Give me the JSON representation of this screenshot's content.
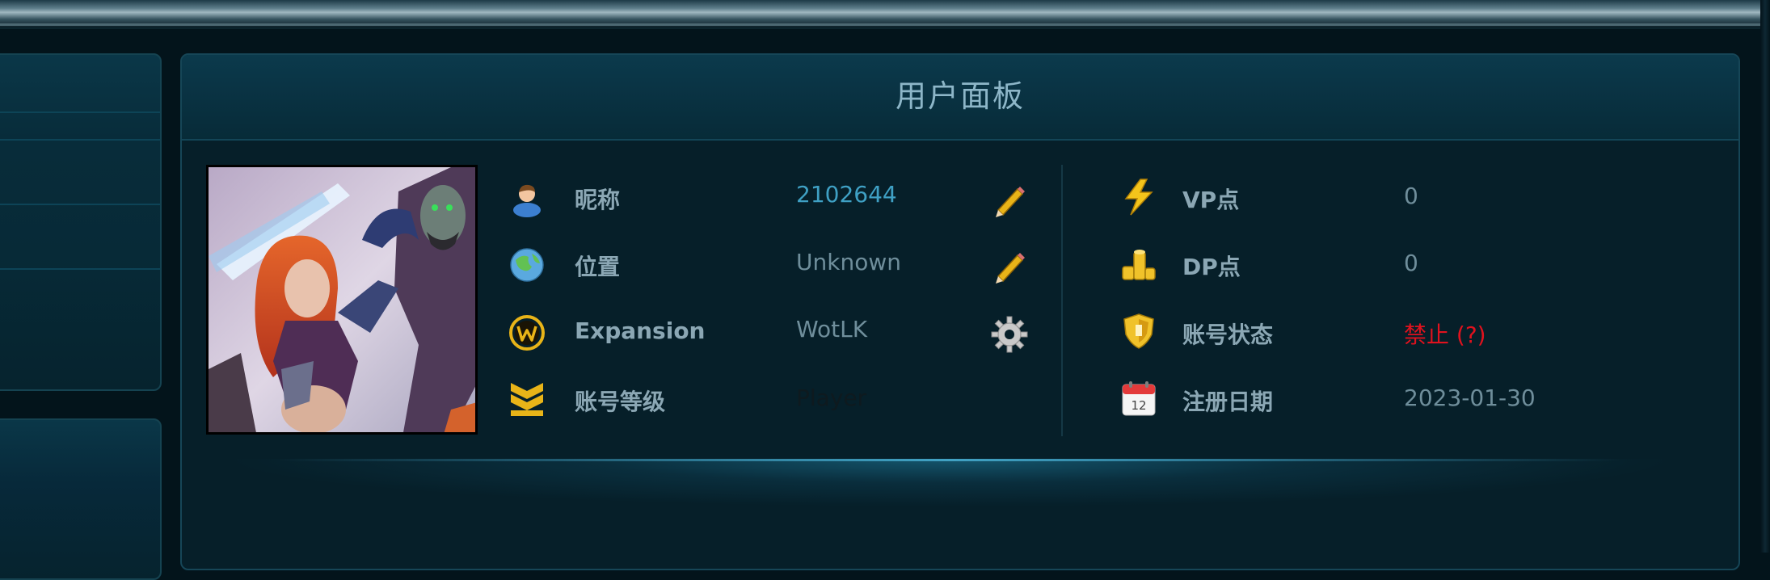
{
  "panel": {
    "title": "用户面板"
  },
  "account": {
    "left_rows": [
      {
        "key": "nickname",
        "label": "昵称",
        "value": "2102644",
        "icon": "user-icon",
        "action": "pencil-icon"
      },
      {
        "key": "location",
        "label": "位置",
        "value": "Unknown",
        "icon": "globe-icon",
        "action": "pencil-icon"
      },
      {
        "key": "expansion",
        "label": "Expansion",
        "value": "WotLK",
        "icon": "wow-logo-icon",
        "action": "gear-icon"
      },
      {
        "key": "account-level",
        "label": "账号等级",
        "value": "Player",
        "icon": "rank-chevron-icon"
      }
    ],
    "right_rows": [
      {
        "key": "vp",
        "label": "VP点",
        "value": "0",
        "icon": "lightning-icon"
      },
      {
        "key": "dp",
        "label": "DP点",
        "value": "0",
        "icon": "coins-icon"
      },
      {
        "key": "status",
        "label": "账号状态",
        "value": "禁止 (?)",
        "icon": "shield-icon"
      },
      {
        "key": "register-date",
        "label": "注册日期",
        "value": "2023-01-30",
        "icon": "calendar-icon"
      }
    ]
  },
  "colors": {
    "background": "#03141b",
    "panel": "#061f29",
    "title": "#8db6c8",
    "label": "#8ba7b4",
    "value": "#6f8e9b",
    "link": "#3fa0c4",
    "banned": "#e0121e",
    "icon_gold": "#e8b418"
  }
}
